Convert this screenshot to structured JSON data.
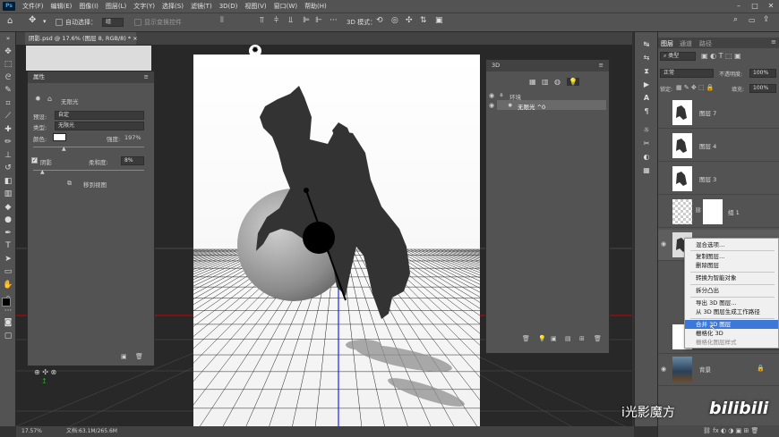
{
  "menubar": {
    "items": [
      "文件(F)",
      "编辑(E)",
      "图像(I)",
      "图层(L)",
      "文字(Y)",
      "选择(S)",
      "滤镜(T)",
      "3D(D)",
      "视图(V)",
      "窗口(W)",
      "帮助(H)"
    ]
  },
  "options": {
    "auto_select_label": "自动选择：",
    "auto_select_value": "组",
    "show_transform_label": "显示变换控件",
    "mode_3d_label": "3D 模式："
  },
  "document": {
    "tab_title": "阴影.psd @ 17.6% (图层 8, RGB/8) *",
    "zoom": "17.57%",
    "doc_info": "文档:63.1M/265.6M"
  },
  "properties": {
    "title": "属性",
    "light_name": "无限光",
    "preset_label": "预设:",
    "preset_value": "自定",
    "type_label": "类型:",
    "type_value": "无限光",
    "color_label": "颜色:",
    "intensity_label": "强度:",
    "intensity_value": "197%",
    "shadow_label": "阴影",
    "softness_label": "柔和度:",
    "softness_value": "8%",
    "move_to_view": "移到视图",
    "intensity_level": 0.3,
    "softness_level": 0.08
  },
  "panel3d": {
    "title": "3D",
    "items": [
      "环境",
      "无限光 ^0"
    ]
  },
  "layers": {
    "tabs": [
      "图层",
      "通道",
      "路径"
    ],
    "kind_label": "类型",
    "blend_mode": "正常",
    "opacity_label": "不透明度:",
    "opacity_value": "100%",
    "lock_label": "锁定:",
    "fill_label": "填充:",
    "fill_value": "100%",
    "rows": [
      "图层 7",
      "图层 4",
      "图层 3",
      "组 1",
      "背景"
    ]
  },
  "context_menu": {
    "items": [
      "混合选项...",
      "复制图层...",
      "删除图层",
      "转换为智能对象",
      "拆分凸出",
      "导出 3D 图层...",
      "从 3D 图层生成工作路径",
      "合并 3D 图层",
      "栅格化 3D",
      "栅格化图层样式"
    ],
    "highlighted": "合并 3D 图层"
  },
  "watermark": {
    "left": "i光影魔方",
    "right": "bilibili"
  },
  "colors": {
    "accent": "#3b78d8",
    "horizon_red": "#cc0000",
    "axis_blue": "#2020ff"
  }
}
